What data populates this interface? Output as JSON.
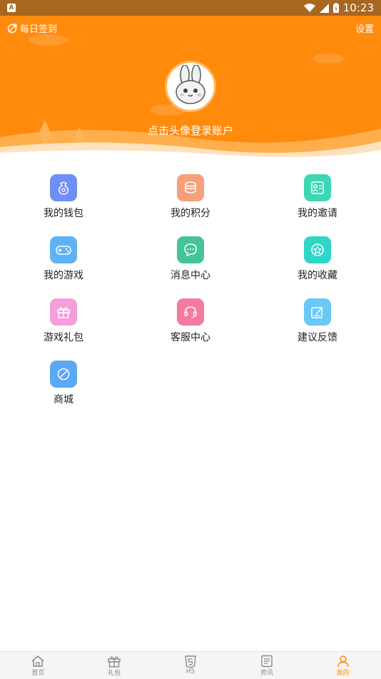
{
  "status_bar": {
    "badge": "A",
    "time": "10:23"
  },
  "header": {
    "checkin_label": "每日签到",
    "settings_label": "设置",
    "login_prompt": "点击头像登录账户"
  },
  "menu": [
    {
      "label": "我的钱包",
      "color": "#6f8ff5"
    },
    {
      "label": "我的积分",
      "color": "#f5a07a"
    },
    {
      "label": "我的邀请",
      "color": "#3dd6b4"
    },
    {
      "label": "我的游戏",
      "color": "#5eb2f6"
    },
    {
      "label": "消息中心",
      "color": "#44c497"
    },
    {
      "label": "我的收藏",
      "color": "#2ed6c7"
    },
    {
      "label": "游戏礼包",
      "color": "#f59ed9"
    },
    {
      "label": "客服中心",
      "color": "#f47aa0"
    },
    {
      "label": "建议反馈",
      "color": "#68c8f6"
    },
    {
      "label": "商城",
      "color": "#5aa9f5"
    }
  ],
  "tabs": [
    {
      "label": "首页",
      "icon": "home-icon"
    },
    {
      "label": "礼包",
      "icon": "gift-icon"
    },
    {
      "label": "H5",
      "icon": "html5-icon"
    },
    {
      "label": "资讯",
      "icon": "news-icon"
    },
    {
      "label": "我的",
      "icon": "person-icon",
      "active": true
    }
  ],
  "colors": {
    "accent": "#ff8a0c",
    "inactive": "#8a8a8a"
  }
}
